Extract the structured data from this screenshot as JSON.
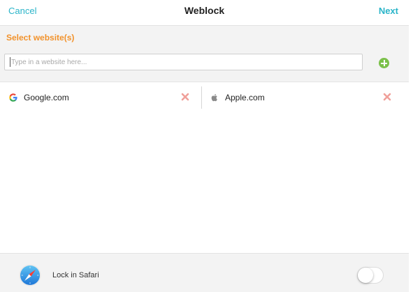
{
  "navbar": {
    "cancel_label": "Cancel",
    "title": "Weblock",
    "next_label": "Next"
  },
  "select": {
    "section_label": "Select website(s)",
    "input_value": "",
    "input_placeholder": "Type in a website here...",
    "add_icon": "plus-circle-icon"
  },
  "websites": [
    {
      "label": "Google.com",
      "icon": "google-icon",
      "remove_icon": "remove-x-icon"
    },
    {
      "label": "Apple.com",
      "icon": "apple-icon",
      "remove_icon": "remove-x-icon"
    }
  ],
  "bottom": {
    "icon": "safari-compass-icon",
    "lock_label": "Lock in Safari",
    "toggle_on": false
  },
  "colors": {
    "accent": "#2bb5c9",
    "section_label": "#f2922b",
    "add_button": "#7bc04a",
    "remove_x": "#f0a09a"
  }
}
